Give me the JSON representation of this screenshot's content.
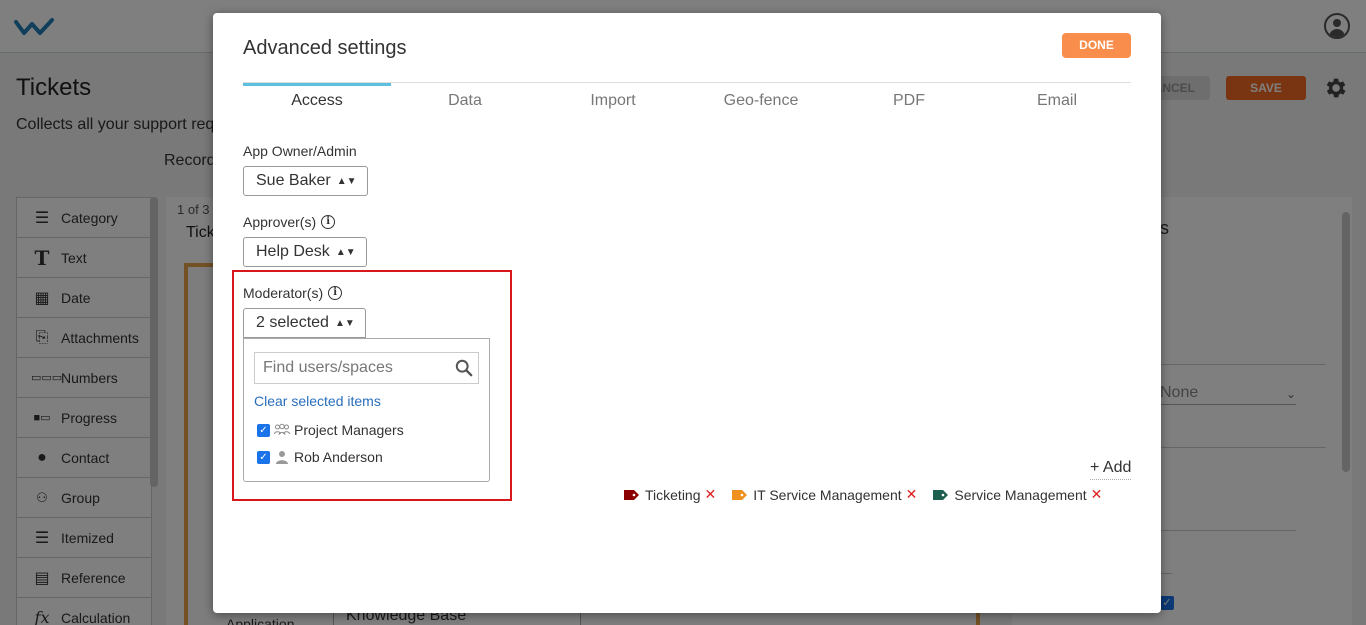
{
  "app": {
    "page_title": "Tickets",
    "page_description": "Collects all your support req",
    "page_tab": "Record",
    "cancel_label": "CANCEL",
    "save_label": "SAVE",
    "accent_color": "#f26b22"
  },
  "fields": [
    {
      "label": "Category",
      "icon": "list-icon"
    },
    {
      "label": "Text",
      "icon": "text-icon"
    },
    {
      "label": "Date",
      "icon": "calendar-icon"
    },
    {
      "label": "Attachments",
      "icon": "paperclip-icon"
    },
    {
      "label": "Numbers",
      "icon": "numbers-icon"
    },
    {
      "label": "Progress",
      "icon": "progress-icon"
    },
    {
      "label": "Contact",
      "icon": "contact-icon"
    },
    {
      "label": "Group",
      "icon": "group-icon"
    },
    {
      "label": "Itemized",
      "icon": "itemized-icon"
    },
    {
      "label": "Reference",
      "icon": "document-icon"
    },
    {
      "label": "Calculation",
      "icon": "fx-icon"
    }
  ],
  "canvas": {
    "count": "1 of 3",
    "subtitle": "Tick",
    "select_value": "Knowledge Base",
    "bottom_label": "Application"
  },
  "right_panel": {
    "heading_fragment": "s",
    "select_value": "None"
  },
  "modal": {
    "title": "Advanced settings",
    "done_label": "DONE",
    "done_color": "#f98d4b",
    "tabs": [
      "Access",
      "Data",
      "Import",
      "Geo-fence",
      "PDF",
      "Email"
    ],
    "active_tab": "Access",
    "owner": {
      "label": "App Owner/Admin",
      "value": "Sue Baker"
    },
    "approvers": {
      "label": "Approver(s)",
      "value": "Help Desk"
    },
    "moderators": {
      "label": "Moderator(s)",
      "value": "2 selected",
      "search_placeholder": "Find users/spaces",
      "clear_label": "Clear selected items",
      "options": [
        {
          "label": "Project Managers",
          "type": "group-icon",
          "checked": true
        },
        {
          "label": "Rob Anderson",
          "type": "user-icon",
          "checked": true
        }
      ]
    },
    "add_label": "+ Add",
    "tags": [
      {
        "label": "Ticketing",
        "color": "#8b0000"
      },
      {
        "label": "IT Service Management",
        "color": "#f0901e"
      },
      {
        "label": "Service Management",
        "color": "#1f5f4f"
      }
    ],
    "remove_glyph": "✕"
  }
}
